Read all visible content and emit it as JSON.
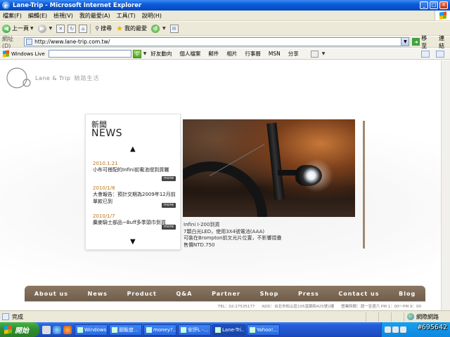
{
  "window": {
    "title": "Lane-Trip - Microsoft Internet Explorer"
  },
  "menubar": {
    "items": [
      "檔案(F)",
      "編輯(E)",
      "檢視(V)",
      "我的最愛(A)",
      "工具(T)",
      "說明(H)"
    ]
  },
  "toolbar": {
    "back_label": "上一頁",
    "search_label": "搜尋",
    "favorites_label": "我的最愛"
  },
  "address": {
    "label": "網址(D)",
    "url": "http://www.lane-trip.com.tw/",
    "go_label": "移至",
    "links_label": "連結"
  },
  "livebar": {
    "logo_text": "Windows Live",
    "links": [
      "好友動向",
      "個人檔案",
      "郵件",
      "相片",
      "行事曆",
      "MSN",
      "分享"
    ]
  },
  "site": {
    "logo_text": "Lane & Trip",
    "logo_sub": "騎路生活",
    "news": {
      "heading_zh": "新聞",
      "heading_en": "NEWS",
      "up_arrow": "▲",
      "down_arrow": "▼",
      "more_label": "more",
      "items": [
        {
          "date": "2010.1.21",
          "title": "小布可搭配的Infini前電池燈到貨曬"
        },
        {
          "date": "2010/1/8",
          "title": "大會報告：預計交期為2009年12月前單款已到"
        },
        {
          "date": "2010/1/7",
          "title": "麋麥騎士部品~Buff多季頭巾到貨"
        }
      ]
    },
    "caption": [
      "Infini I-200到貨",
      "7顆白光LED，使用3X4號電池(AAA)",
      "可裝在Brompton前叉光片位置，不影響摺疊",
      "售價NTD.750"
    ],
    "nav": [
      "About us",
      "News",
      "Product",
      "Q&A",
      "Partner",
      "Shop",
      "Press",
      "Contact us",
      "Blog"
    ],
    "footer": {
      "tel": "TEL：02-27535177",
      "addr": "ADD：台北市松山區105富錦街425號1樓",
      "hours": "營業時間：週一至週六 PM 1：00～PM 9：00"
    }
  },
  "status": {
    "text": "完成",
    "zone": "網際網路"
  },
  "taskbar": {
    "start_label": "開始",
    "tasks": [
      "Windows...",
      "朋飯度...",
      "money?...",
      "安評L -...",
      "Lane-Tri...",
      "Yahoo!..."
    ]
  },
  "watermark": "#695642"
}
